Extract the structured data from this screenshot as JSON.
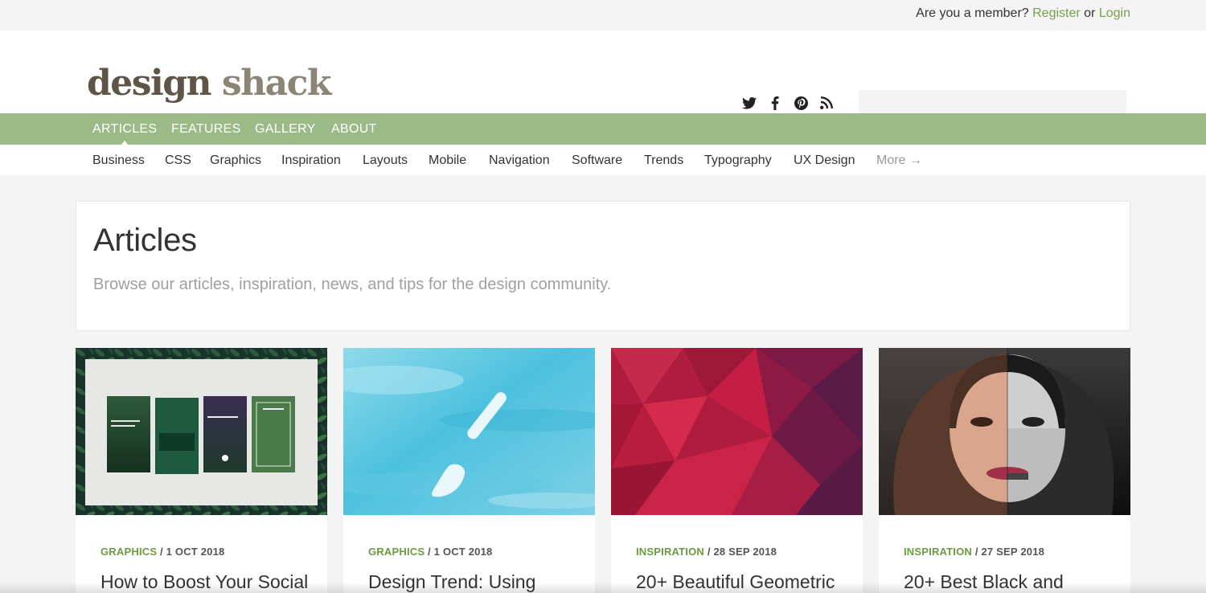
{
  "topbar": {
    "question": "Are you a member?",
    "register": "Register",
    "or": "or",
    "login": "Login"
  },
  "logo": {
    "part1": "design",
    "part2": "shack"
  },
  "social_icons": [
    "twitter-icon",
    "facebook-icon",
    "pinterest-icon",
    "rss-icon"
  ],
  "search": {
    "placeholder": ""
  },
  "nav": {
    "items": [
      "ARTICLES",
      "FEATURES",
      "GALLERY",
      "ABOUT"
    ],
    "active": "ARTICLES"
  },
  "subnav": {
    "items": [
      "Business",
      "CSS",
      "Graphics",
      "Inspiration",
      "Layouts",
      "Mobile",
      "Navigation",
      "Software",
      "Trends",
      "Typography",
      "UX Design"
    ],
    "more": "More →"
  },
  "intro": {
    "title": "Articles",
    "subtitle": "Browse our articles, inspiration, news, and tips for the design community."
  },
  "cards": [
    {
      "category": "GRAPHICS",
      "date": " / 1 OCT 2018",
      "title": "How to Boost Your Social"
    },
    {
      "category": "GRAPHICS",
      "date": " / 1 OCT 2018",
      "title": "Design Trend: Using"
    },
    {
      "category": "INSPIRATION",
      "date": " / 28 SEP 2018",
      "title": "20+ Beautiful Geometric"
    },
    {
      "category": "INSPIRATION",
      "date": " / 27 SEP 2018",
      "title": "20+ Best Black and"
    }
  ],
  "colors": {
    "accent": "#76a04b",
    "nav_bg": "#9aba87",
    "category": "#6d9a40"
  }
}
